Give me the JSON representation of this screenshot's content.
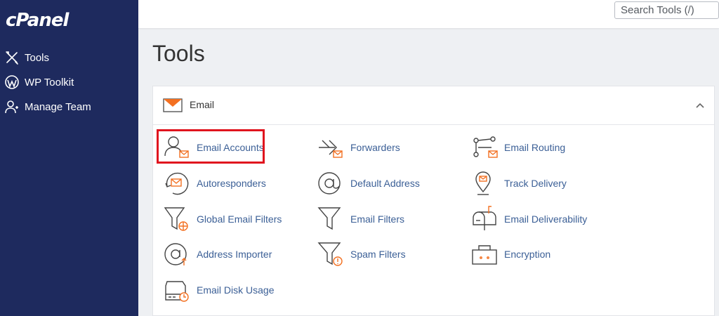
{
  "brand": {
    "logo_text": "cPanel"
  },
  "sidebar": {
    "items": [
      {
        "label": "Tools",
        "icon": "tools-icon"
      },
      {
        "label": "WP Toolkit",
        "icon": "wordpress-icon"
      },
      {
        "label": "Manage Team",
        "icon": "manage-team-icon"
      }
    ]
  },
  "search": {
    "placeholder": "Search Tools (/)"
  },
  "page": {
    "title": "Tools"
  },
  "email_section": {
    "title": "Email",
    "icon": "envelope-icon",
    "expanded": true,
    "tools": [
      {
        "label": "Email Accounts",
        "icon": "email-accounts-icon",
        "highlighted": true
      },
      {
        "label": "Forwarders",
        "icon": "forwarders-icon"
      },
      {
        "label": "Email Routing",
        "icon": "email-routing-icon"
      },
      {
        "label": "Autoresponders",
        "icon": "autoresponders-icon"
      },
      {
        "label": "Default Address",
        "icon": "default-address-icon"
      },
      {
        "label": "Track Delivery",
        "icon": "track-delivery-icon"
      },
      {
        "label": "Global Email Filters",
        "icon": "global-email-filters-icon"
      },
      {
        "label": "Email Filters",
        "icon": "email-filters-icon"
      },
      {
        "label": "Email Deliverability",
        "icon": "email-deliverability-icon"
      },
      {
        "label": "Address Importer",
        "icon": "address-importer-icon"
      },
      {
        "label": "Spam Filters",
        "icon": "spam-filters-icon"
      },
      {
        "label": "Encryption",
        "icon": "encryption-icon"
      },
      {
        "label": "Email Disk Usage",
        "icon": "email-disk-usage-icon"
      }
    ]
  },
  "colors": {
    "sidebar_bg": "#1e2a5e",
    "link": "#3b5f96",
    "accent_orange": "#f37021",
    "highlight_border": "#e0141e"
  }
}
